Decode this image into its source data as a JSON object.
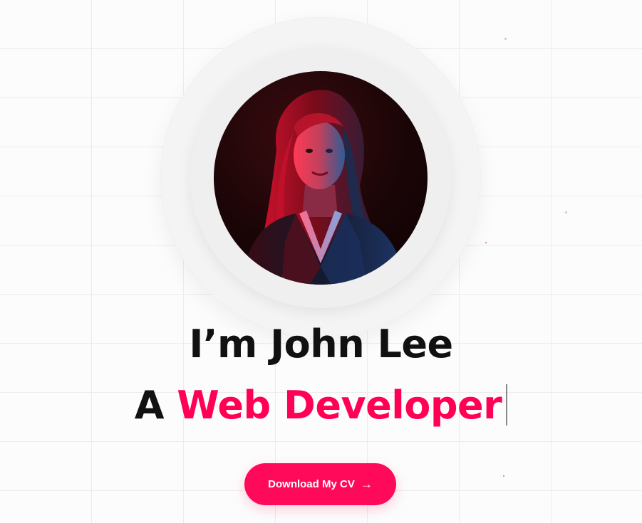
{
  "hero": {
    "greeting": "I’m John Lee",
    "role_prefix": "A ",
    "role": "Web Developer",
    "cta_label": "Download My CV",
    "cta_icon": "arrow-right-icon",
    "avatar_alt": "Portrait photo"
  },
  "colors": {
    "accent": "#ff0055",
    "button": "#ff0a5a",
    "text": "#111111",
    "background": "#fcfcfc"
  }
}
